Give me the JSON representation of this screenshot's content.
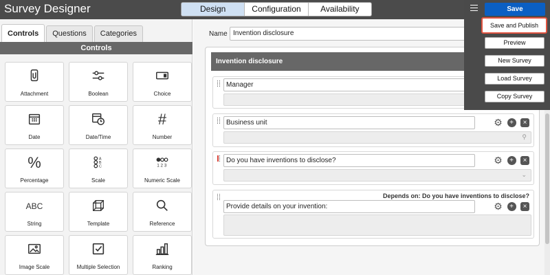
{
  "app": {
    "title": "Survey Designer"
  },
  "top_tabs": [
    {
      "label": "Design",
      "active": true
    },
    {
      "label": "Configuration",
      "active": false
    },
    {
      "label": "Availability",
      "active": false
    }
  ],
  "left_panel": {
    "tabs": [
      {
        "label": "Controls",
        "active": true
      },
      {
        "label": "Questions",
        "active": false
      },
      {
        "label": "Categories",
        "active": false
      }
    ],
    "heading": "Controls",
    "controls": [
      {
        "label": "Attachment",
        "icon": "attachment-icon"
      },
      {
        "label": "Boolean",
        "icon": "toggle-icon"
      },
      {
        "label": "Choice",
        "icon": "dropdown-choice-icon"
      },
      {
        "label": "Date",
        "icon": "calendar-icon"
      },
      {
        "label": "Date/Time",
        "icon": "calendar-clock-icon"
      },
      {
        "label": "Number",
        "icon": "hash-icon"
      },
      {
        "label": "Percentage",
        "icon": "percent-icon"
      },
      {
        "label": "Scale",
        "icon": "scale-abc-icon"
      },
      {
        "label": "Numeric Scale",
        "icon": "numeric-scale-icon"
      },
      {
        "label": "String",
        "icon": "abc-text-icon"
      },
      {
        "label": "Template",
        "icon": "cube-icon"
      },
      {
        "label": "Reference",
        "icon": "magnifier-icon"
      },
      {
        "label": "Image Scale",
        "icon": "image-icon"
      },
      {
        "label": "Multiple Selection",
        "icon": "checkbox-icon"
      },
      {
        "label": "Ranking",
        "icon": "bar-chart-icon"
      }
    ]
  },
  "survey": {
    "name_label": "Name",
    "name_value": "Invention disclosure",
    "section_title": "Invention disclosure",
    "questions": [
      {
        "text": "Manager",
        "answer_type": "reference",
        "depends_on": ""
      },
      {
        "text": "Business unit",
        "answer_type": "reference",
        "depends_on": ""
      },
      {
        "text": "Do you have inventions to disclose?",
        "answer_type": "choice",
        "depends_on": ""
      },
      {
        "text": "Provide details on your invention:",
        "answer_type": "multiline",
        "depends_on": "Depends on: Do you have inventions to disclose?"
      }
    ]
  },
  "menu": {
    "save": "Save",
    "items": [
      "Save and Publish",
      "Preview",
      "New Survey",
      "Load Survey",
      "Copy Survey"
    ],
    "highlighted": "Save and Publish"
  },
  "icons": {
    "search": "⚲",
    "chevron_down": "⌄",
    "add": "+",
    "remove": "×",
    "settings": "⚙"
  },
  "colors": {
    "header_bg": "#4b4b4b",
    "primary_button": "#0b5fc3",
    "highlight_outline": "#e0533f",
    "active_tab": "#cfe0f3"
  }
}
